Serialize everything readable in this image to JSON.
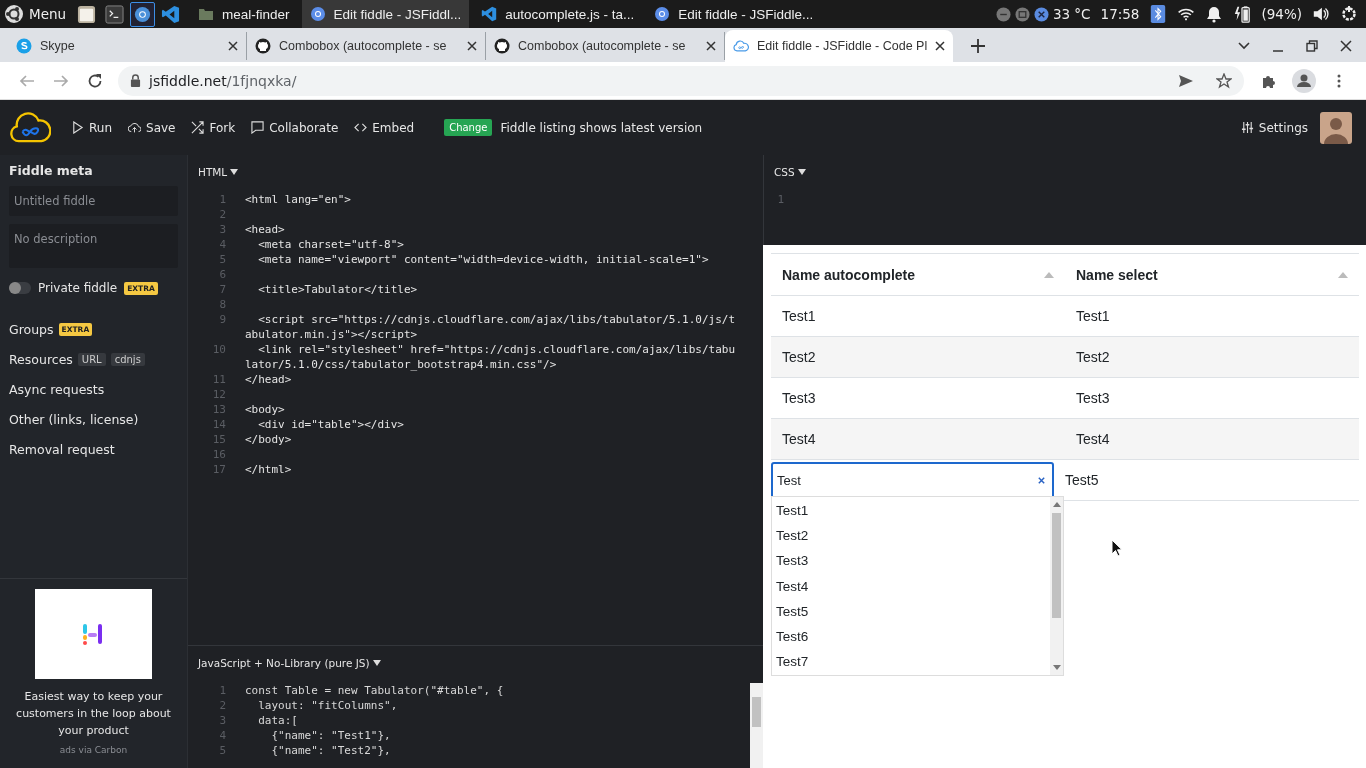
{
  "taskbar": {
    "menu_label": "Menu",
    "launchers": [
      {
        "kind": "files",
        "selected": false
      },
      {
        "kind": "terminal",
        "selected": false
      },
      {
        "kind": "chromium",
        "selected": true
      },
      {
        "kind": "vscode",
        "selected": false
      }
    ],
    "windows": [
      {
        "title": "meal-finder",
        "kind": "folder",
        "selected": false
      },
      {
        "title": "Edit fiddle - JSFiddl...",
        "kind": "chromium",
        "selected": true
      },
      {
        "title": "autocomplete.js - ta...",
        "kind": "vscode",
        "selected": false
      },
      {
        "title": "Edit fiddle - JSFiddle...",
        "kind": "chromium",
        "selected": false
      }
    ],
    "temperature": "33 °C",
    "clock": "17:58",
    "battery": "(94%)"
  },
  "browser": {
    "tabs": [
      {
        "title": "Skype",
        "kind": "skype",
        "selected": false
      },
      {
        "title": "Combobox (autocomplete - se",
        "kind": "github",
        "selected": false
      },
      {
        "title": "Combobox (autocomplete - se",
        "kind": "github",
        "selected": false
      },
      {
        "title": "Edit fiddle - JSFiddle - Code Pl",
        "kind": "jsfiddle",
        "selected": true
      }
    ],
    "url_host": "jsfiddle.net",
    "url_path": "/1fjnqxka/"
  },
  "toolbar": {
    "actions": [
      {
        "label": "Run",
        "kind": "run"
      },
      {
        "label": "Save",
        "kind": "save"
      },
      {
        "label": "Fork",
        "kind": "fork"
      },
      {
        "label": "Collaborate",
        "kind": "collaborate"
      },
      {
        "label": "Embed",
        "kind": "embed"
      }
    ],
    "badge": "Change",
    "notice": "Fiddle listing shows latest version",
    "settings": "Settings"
  },
  "sidebar": {
    "heading": "Fiddle meta",
    "title_placeholder": "Untitled fiddle",
    "description_placeholder": "No description",
    "private": {
      "label": "Private fiddle",
      "on": false,
      "badge": "EXTRA"
    },
    "sections": [
      {
        "label": "Groups",
        "badges": [
          {
            "text": "EXTRA",
            "kind": "extra"
          }
        ]
      },
      {
        "label": "Resources",
        "badges": [
          {
            "text": "URL",
            "kind": "tag"
          },
          {
            "text": "cdnjs",
            "kind": "tag"
          }
        ]
      },
      {
        "label": "Async requests"
      },
      {
        "label": "Other (links, license)"
      },
      {
        "label": "Removal request"
      }
    ],
    "ad": {
      "text": "Easiest way to keep your customers in the loop about your product",
      "credit": "ads via Carbon"
    }
  },
  "html_panel": {
    "label": "HTML",
    "lines": [
      {
        "no": "1",
        "code": "<html lang=\"en\">"
      },
      {
        "no": "2"
      },
      {
        "no": "3",
        "code": "<head>"
      },
      {
        "no": "4",
        "code": "  <meta charset=\"utf-8\">"
      },
      {
        "no": "5",
        "code": "  <meta name=\"viewport\" content=\"width=device-width, initial-scale=1\">"
      },
      {
        "no": "6"
      },
      {
        "no": "7",
        "code": "  <title>Tabulator</title>"
      },
      {
        "no": "8"
      },
      {
        "no": "9",
        "code": "  <script src=\"https://cdnjs.cloudflare.com/ajax/libs/tabulator/5.1.0/js/tabulator.min.js\"></script>"
      },
      {
        "no": "10",
        "code": "  <link rel=\"stylesheet\" href=\"https://cdnjs.cloudflare.com/ajax/libs/tabulator/5.1.0/css/tabulator_bootstrap4.min.css\"/>"
      },
      {
        "no": "11",
        "code": "</head>"
      },
      {
        "no": "12"
      },
      {
        "no": "13",
        "code": "<body>"
      },
      {
        "no": "14",
        "code": "  <div id=\"table\"></div>"
      },
      {
        "no": "15",
        "code": "</body>"
      },
      {
        "no": "16"
      },
      {
        "no": "17",
        "code": "</html>"
      }
    ]
  },
  "js_panel": {
    "label": "JavaScript + No-Library (pure JS)",
    "lines": [
      {
        "no": "1",
        "code": "const Table = new Tabulator(\"#table\", {"
      },
      {
        "no": "2",
        "code": "  layout: \"fitColumns\","
      },
      {
        "no": "3",
        "code": "  data:["
      },
      {
        "no": "4",
        "code": "    {\"name\": \"Test1\"},"
      },
      {
        "no": "5",
        "code": "    {\"name\": \"Test2\"},"
      }
    ]
  },
  "css_panel": {
    "label": "CSS",
    "lines": [
      {
        "no": "1"
      }
    ]
  },
  "result": {
    "columns": [
      {
        "title": "Name autocomplete"
      },
      {
        "title": "Name select"
      }
    ],
    "rows": [
      {
        "cells": [
          "Test1",
          "Test1"
        ],
        "editing": false
      },
      {
        "cells": [
          "Test2",
          "Test2"
        ],
        "editing": false
      },
      {
        "cells": [
          "Test3",
          "Test3"
        ],
        "editing": false
      },
      {
        "cells": [
          "Test4",
          "Test4"
        ],
        "editing": false
      },
      {
        "cells": [
          "Test",
          "Test5"
        ],
        "editing": true
      }
    ],
    "dropdown": [
      "Test1",
      "Test2",
      "Test3",
      "Test4",
      "Test5",
      "Test6",
      "Test7"
    ]
  }
}
